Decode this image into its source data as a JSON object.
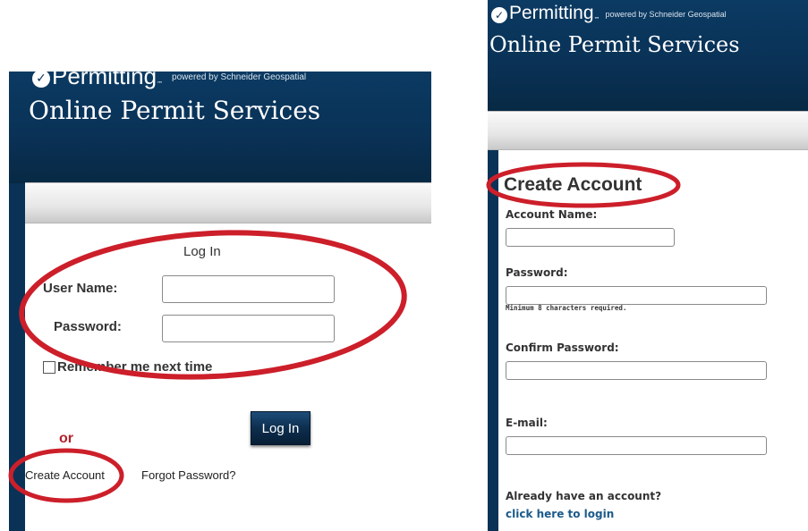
{
  "branding": {
    "logo_text": "Permitting",
    "trademark": "™",
    "powered_by": "powered by Schneider Geospatial",
    "site_title": "Online Permit Services"
  },
  "login": {
    "heading": "Log In",
    "username_label": "User Name:",
    "username_value": "",
    "password_label": "Password:",
    "password_value": "",
    "remember_label": "Remember me next time",
    "remember_checked": false,
    "login_button_label": "Log In",
    "or_text": "or",
    "create_account_link": "Create Account",
    "forgot_password_link": "Forgot Password?"
  },
  "create_account": {
    "heading": "Create Account",
    "account_name_label": "Account Name:",
    "account_name_value": "",
    "password_label": "Password:",
    "password_value": "",
    "password_hint": "Minimum 8 characters required.",
    "confirm_password_label": "Confirm Password:",
    "confirm_password_value": "",
    "email_label": "E-mail:",
    "email_value": "",
    "already_have_account": "Already have an account?",
    "login_link": "click here to login"
  },
  "colors": {
    "header_blue": "#0a3257",
    "annotation_red": "#cc1f2a",
    "link_blue": "#1b5a8a",
    "or_red": "#b3202a"
  },
  "icons": {
    "logo_check": "check-circle-icon"
  }
}
